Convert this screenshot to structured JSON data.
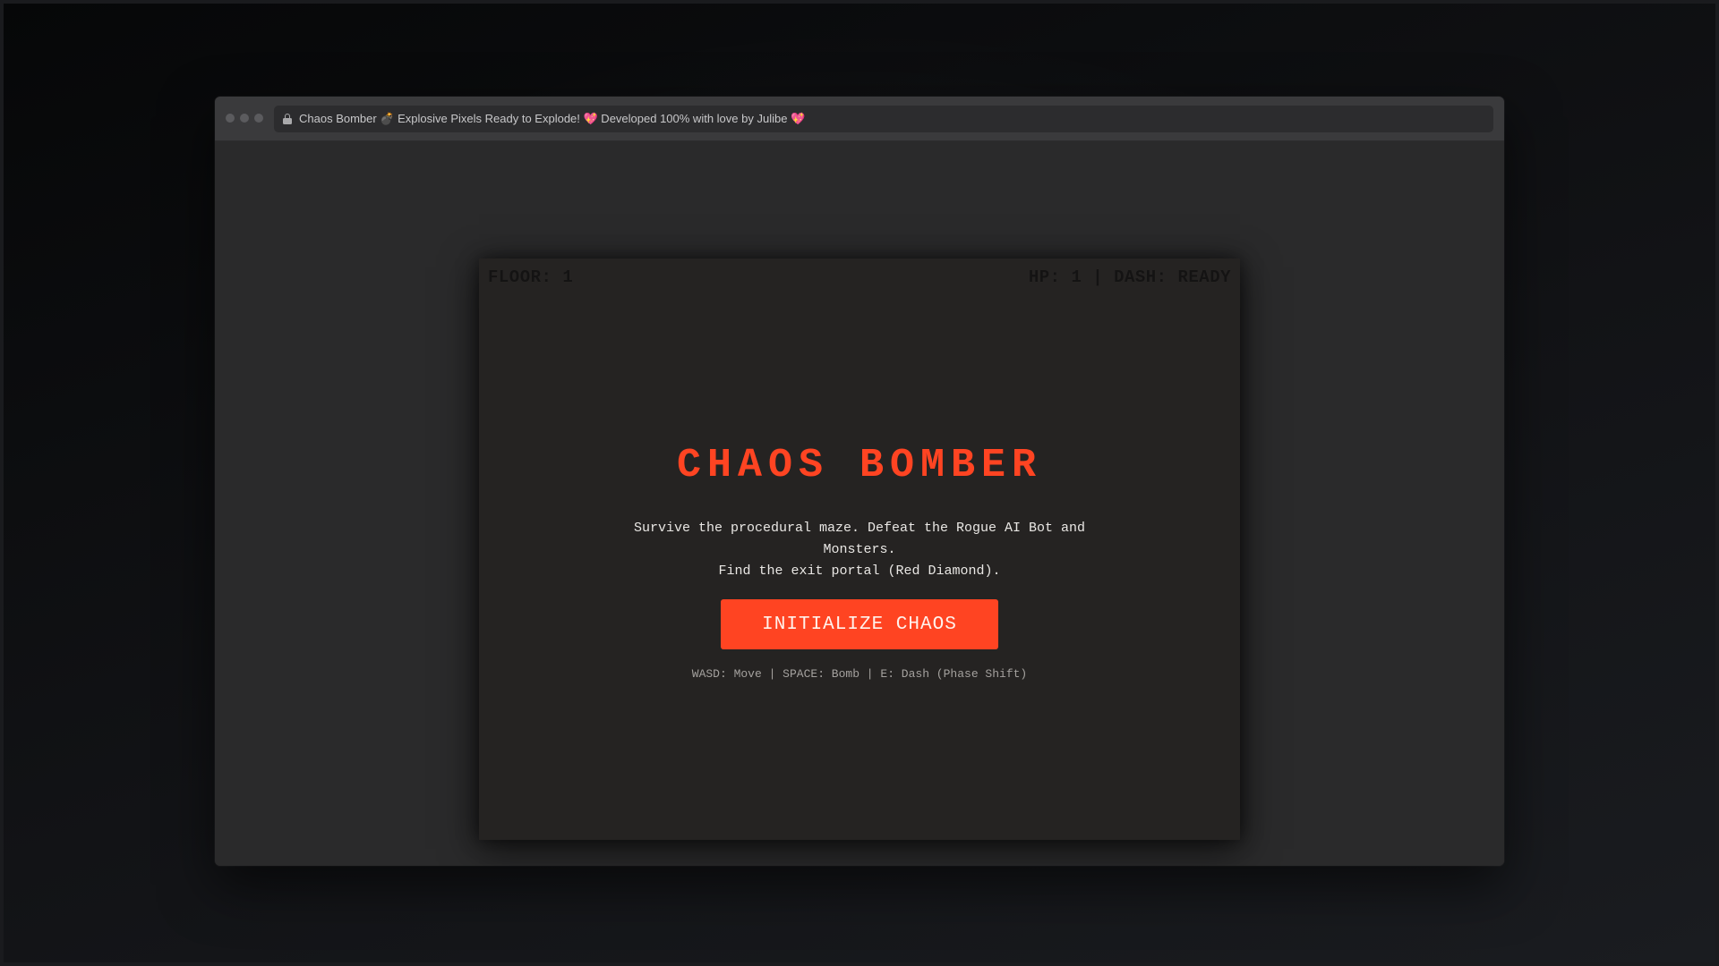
{
  "browser": {
    "tab_title": "Chaos Bomber 💣 Explosive Pixels Ready to Explode! 💖 Developed 100% with love by Julibe 💖"
  },
  "hud": {
    "floor": "FLOOR: 1",
    "status": "HP: 1 | DASH: READY"
  },
  "start_screen": {
    "title": "CHAOS BOMBER",
    "description_line1": "Survive the procedural maze. Defeat the Rogue AI Bot and",
    "description_line2": "Monsters.",
    "description_line3": "Find the exit portal (Red Diamond).",
    "start_button": "INITIALIZE CHAOS",
    "controls": "WASD: Move | SPACE: Bomb | E: Dash (Phase Shift)"
  },
  "colors": {
    "accent": "#ff4422",
    "canvas_bg": "#252322",
    "window_bg": "#2a2a2b"
  }
}
